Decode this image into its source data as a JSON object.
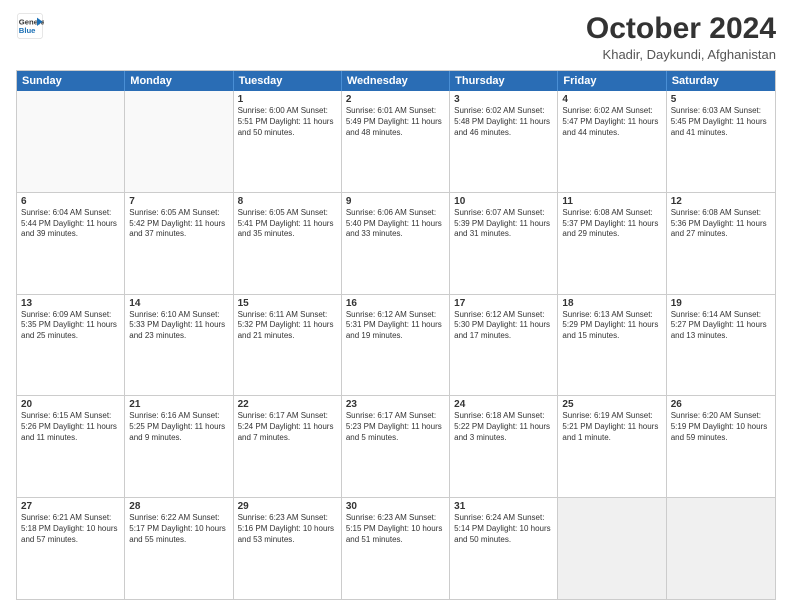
{
  "header": {
    "logo_line1": "General",
    "logo_line2": "Blue",
    "month": "October 2024",
    "location": "Khadir, Daykundi, Afghanistan"
  },
  "days_of_week": [
    "Sunday",
    "Monday",
    "Tuesday",
    "Wednesday",
    "Thursday",
    "Friday",
    "Saturday"
  ],
  "weeks": [
    [
      {
        "day": "",
        "text": "",
        "empty": true
      },
      {
        "day": "",
        "text": "",
        "empty": true
      },
      {
        "day": "1",
        "text": "Sunrise: 6:00 AM\nSunset: 5:51 PM\nDaylight: 11 hours and 50 minutes."
      },
      {
        "day": "2",
        "text": "Sunrise: 6:01 AM\nSunset: 5:49 PM\nDaylight: 11 hours and 48 minutes."
      },
      {
        "day": "3",
        "text": "Sunrise: 6:02 AM\nSunset: 5:48 PM\nDaylight: 11 hours and 46 minutes."
      },
      {
        "day": "4",
        "text": "Sunrise: 6:02 AM\nSunset: 5:47 PM\nDaylight: 11 hours and 44 minutes."
      },
      {
        "day": "5",
        "text": "Sunrise: 6:03 AM\nSunset: 5:45 PM\nDaylight: 11 hours and 41 minutes."
      }
    ],
    [
      {
        "day": "6",
        "text": "Sunrise: 6:04 AM\nSunset: 5:44 PM\nDaylight: 11 hours and 39 minutes."
      },
      {
        "day": "7",
        "text": "Sunrise: 6:05 AM\nSunset: 5:42 PM\nDaylight: 11 hours and 37 minutes."
      },
      {
        "day": "8",
        "text": "Sunrise: 6:05 AM\nSunset: 5:41 PM\nDaylight: 11 hours and 35 minutes."
      },
      {
        "day": "9",
        "text": "Sunrise: 6:06 AM\nSunset: 5:40 PM\nDaylight: 11 hours and 33 minutes."
      },
      {
        "day": "10",
        "text": "Sunrise: 6:07 AM\nSunset: 5:39 PM\nDaylight: 11 hours and 31 minutes."
      },
      {
        "day": "11",
        "text": "Sunrise: 6:08 AM\nSunset: 5:37 PM\nDaylight: 11 hours and 29 minutes."
      },
      {
        "day": "12",
        "text": "Sunrise: 6:08 AM\nSunset: 5:36 PM\nDaylight: 11 hours and 27 minutes."
      }
    ],
    [
      {
        "day": "13",
        "text": "Sunrise: 6:09 AM\nSunset: 5:35 PM\nDaylight: 11 hours and 25 minutes."
      },
      {
        "day": "14",
        "text": "Sunrise: 6:10 AM\nSunset: 5:33 PM\nDaylight: 11 hours and 23 minutes."
      },
      {
        "day": "15",
        "text": "Sunrise: 6:11 AM\nSunset: 5:32 PM\nDaylight: 11 hours and 21 minutes."
      },
      {
        "day": "16",
        "text": "Sunrise: 6:12 AM\nSunset: 5:31 PM\nDaylight: 11 hours and 19 minutes."
      },
      {
        "day": "17",
        "text": "Sunrise: 6:12 AM\nSunset: 5:30 PM\nDaylight: 11 hours and 17 minutes."
      },
      {
        "day": "18",
        "text": "Sunrise: 6:13 AM\nSunset: 5:29 PM\nDaylight: 11 hours and 15 minutes."
      },
      {
        "day": "19",
        "text": "Sunrise: 6:14 AM\nSunset: 5:27 PM\nDaylight: 11 hours and 13 minutes."
      }
    ],
    [
      {
        "day": "20",
        "text": "Sunrise: 6:15 AM\nSunset: 5:26 PM\nDaylight: 11 hours and 11 minutes."
      },
      {
        "day": "21",
        "text": "Sunrise: 6:16 AM\nSunset: 5:25 PM\nDaylight: 11 hours and 9 minutes."
      },
      {
        "day": "22",
        "text": "Sunrise: 6:17 AM\nSunset: 5:24 PM\nDaylight: 11 hours and 7 minutes."
      },
      {
        "day": "23",
        "text": "Sunrise: 6:17 AM\nSunset: 5:23 PM\nDaylight: 11 hours and 5 minutes."
      },
      {
        "day": "24",
        "text": "Sunrise: 6:18 AM\nSunset: 5:22 PM\nDaylight: 11 hours and 3 minutes."
      },
      {
        "day": "25",
        "text": "Sunrise: 6:19 AM\nSunset: 5:21 PM\nDaylight: 11 hours and 1 minute."
      },
      {
        "day": "26",
        "text": "Sunrise: 6:20 AM\nSunset: 5:19 PM\nDaylight: 10 hours and 59 minutes."
      }
    ],
    [
      {
        "day": "27",
        "text": "Sunrise: 6:21 AM\nSunset: 5:18 PM\nDaylight: 10 hours and 57 minutes."
      },
      {
        "day": "28",
        "text": "Sunrise: 6:22 AM\nSunset: 5:17 PM\nDaylight: 10 hours and 55 minutes."
      },
      {
        "day": "29",
        "text": "Sunrise: 6:23 AM\nSunset: 5:16 PM\nDaylight: 10 hours and 53 minutes."
      },
      {
        "day": "30",
        "text": "Sunrise: 6:23 AM\nSunset: 5:15 PM\nDaylight: 10 hours and 51 minutes."
      },
      {
        "day": "31",
        "text": "Sunrise: 6:24 AM\nSunset: 5:14 PM\nDaylight: 10 hours and 50 minutes."
      },
      {
        "day": "",
        "text": "",
        "empty": true
      },
      {
        "day": "",
        "text": "",
        "empty": true
      }
    ]
  ]
}
